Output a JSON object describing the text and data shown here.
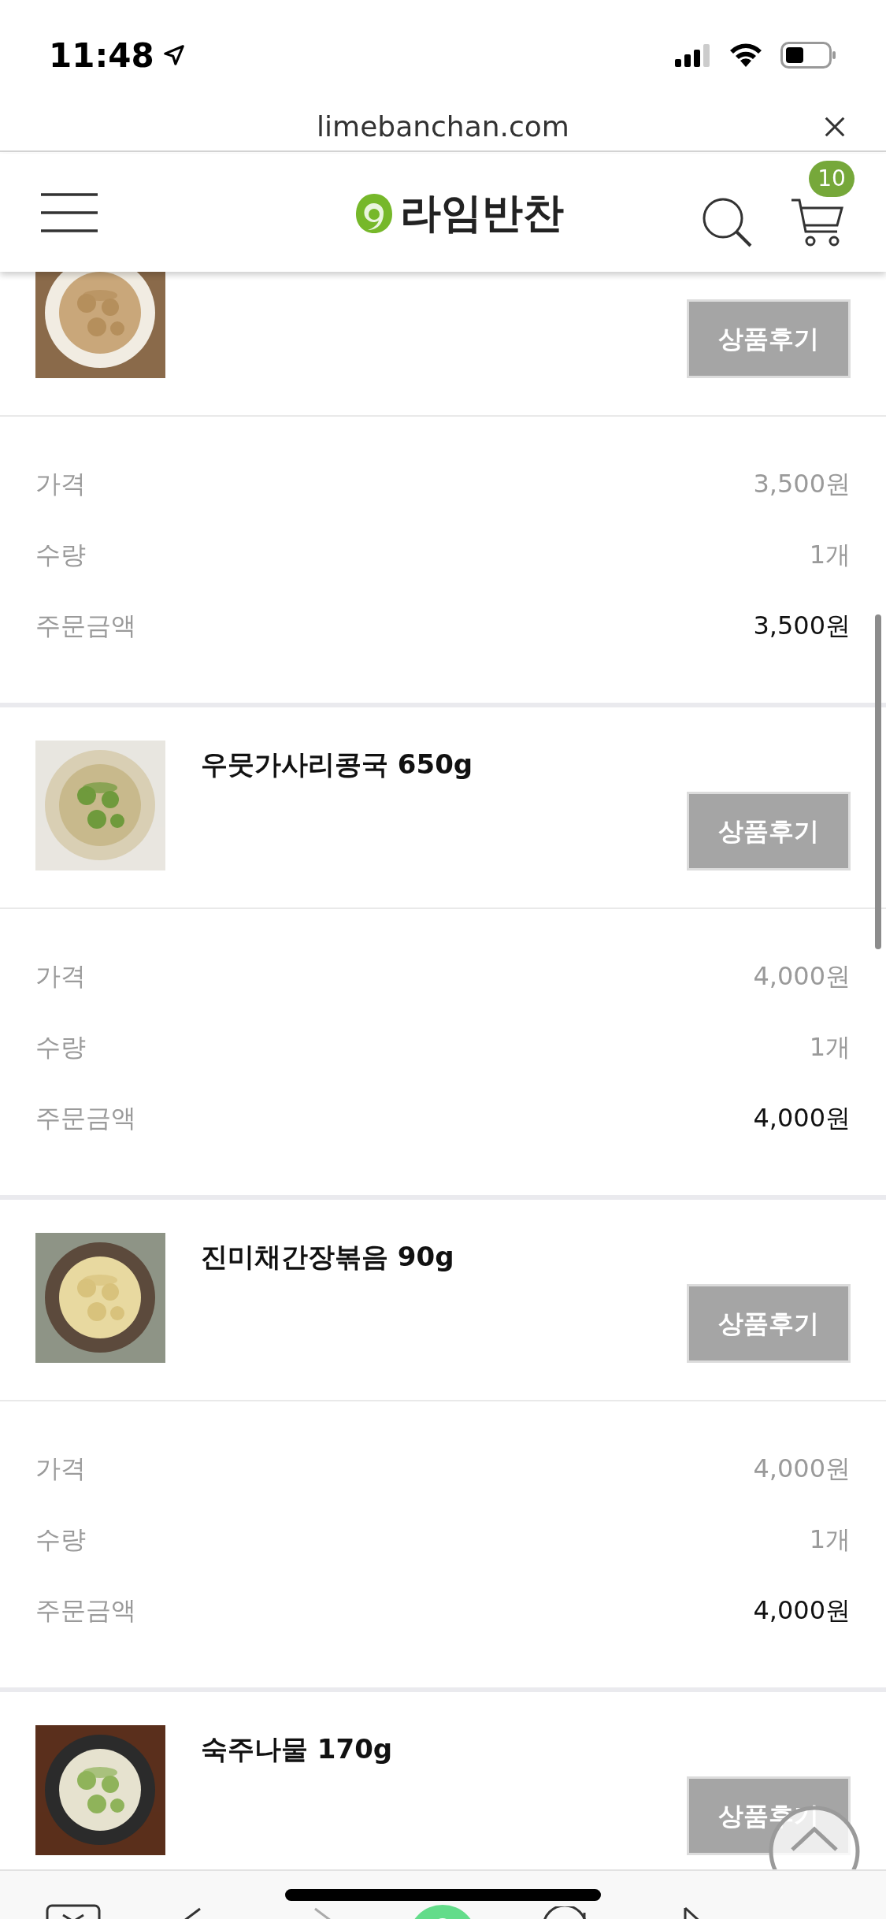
{
  "status_bar": {
    "time": "11:48"
  },
  "browser": {
    "url": "limebanchan.com"
  },
  "header": {
    "logo_text": "라임반찬",
    "cart_count": "10"
  },
  "orders": [
    {
      "review_button": "상품후기",
      "rows": [
        {
          "label": "가격",
          "value": "3,500원",
          "emphasized": false
        },
        {
          "label": "수량",
          "value": "1개",
          "emphasized": false
        },
        {
          "label": "주문금액",
          "value": "3,500원",
          "emphasized": true
        }
      ]
    },
    {
      "name": "우뭇가사리콩국 650g",
      "review_button": "상품후기",
      "rows": [
        {
          "label": "가격",
          "value": "4,000원",
          "emphasized": false
        },
        {
          "label": "수량",
          "value": "1개",
          "emphasized": false
        },
        {
          "label": "주문금액",
          "value": "4,000원",
          "emphasized": true
        }
      ]
    },
    {
      "name": "진미채간장볶음 90g",
      "review_button": "상품후기",
      "rows": [
        {
          "label": "가격",
          "value": "4,000원",
          "emphasized": false
        },
        {
          "label": "수량",
          "value": "1개",
          "emphasized": false
        },
        {
          "label": "주문금액",
          "value": "4,000원",
          "emphasized": true
        }
      ]
    },
    {
      "name": "숙주나물 170g",
      "review_button": "상품후기"
    }
  ]
}
